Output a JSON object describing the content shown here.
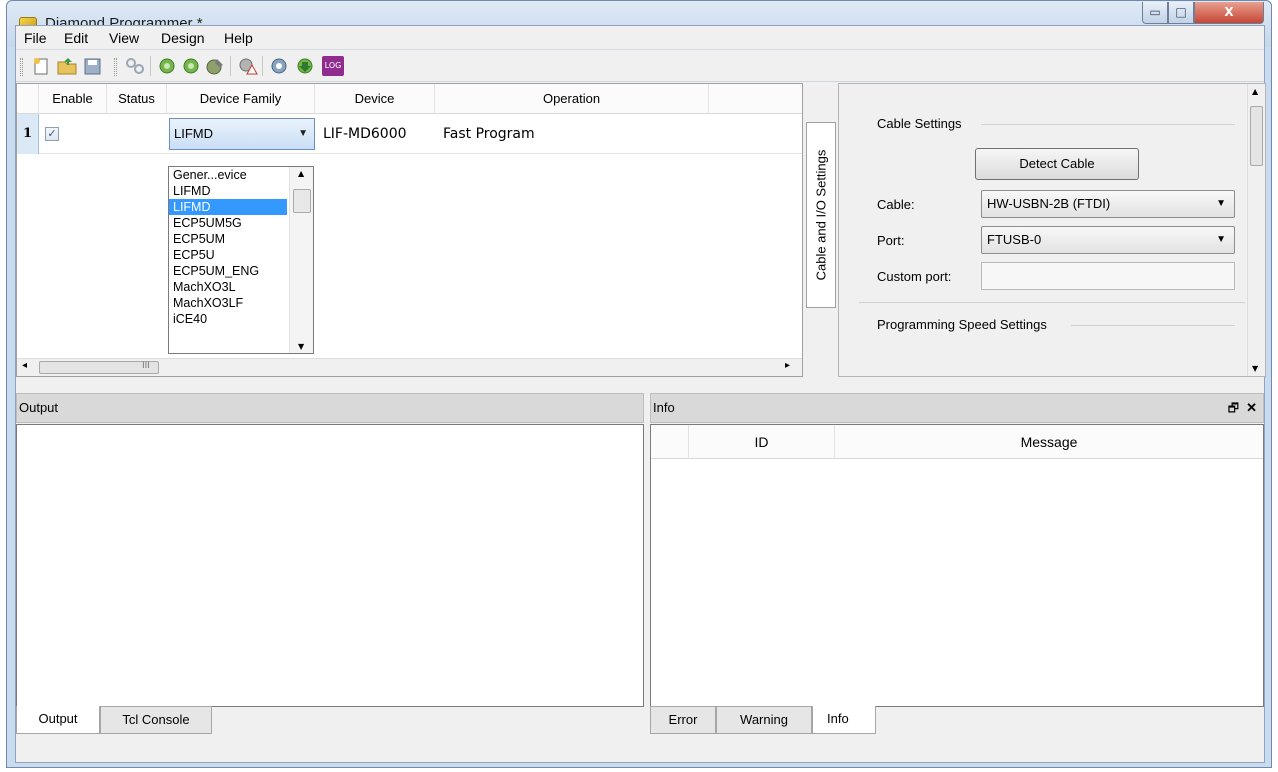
{
  "window": {
    "title": "Diamond Programmer *",
    "minimize_glyph": "▭",
    "maximize_glyph": "□",
    "close_glyph": "X"
  },
  "menu": [
    "File",
    "Edit",
    "View",
    "Design",
    "Help"
  ],
  "toolbar": {
    "logo_text": "LOG"
  },
  "device_table": {
    "headers": [
      "Enable",
      "Status",
      "Device Family",
      "Device",
      "Operation"
    ],
    "row": {
      "number": "1",
      "checked_glyph": "✓",
      "family": "LIFMD",
      "device": "LIF-MD6000",
      "operation": "Fast Program"
    },
    "family_options": [
      "Gener...evice",
      "LIFMD",
      "LIFMD",
      "ECP5UM5G",
      "ECP5UM",
      "ECP5U",
      "ECP5UM_ENG",
      "MachXO3L",
      "MachXO3LF",
      "iCE40"
    ],
    "selected_option_index": 2,
    "hscroll_label": "III"
  },
  "side_tab": {
    "label": "Cable and I/O Settings"
  },
  "settings": {
    "cable_group": "Cable Settings",
    "detect_button": "Detect Cable",
    "cable_label": "Cable:",
    "cable_value": "HW-USBN-2B (FTDI)",
    "port_label": "Port:",
    "port_value": "FTUSB-0",
    "custom_port_label": "Custom port:",
    "custom_port_value": "",
    "speed_group": "Programming Speed Settings"
  },
  "output_panel": {
    "title": "Output",
    "tabs": [
      "Output",
      "Tcl Console"
    ]
  },
  "info_panel": {
    "title": "Info",
    "float_glyph": "🗗",
    "close_glyph": "✕",
    "headers": [
      "ID",
      "Message"
    ],
    "tabs": [
      "Error",
      "Warning",
      "Info"
    ]
  }
}
